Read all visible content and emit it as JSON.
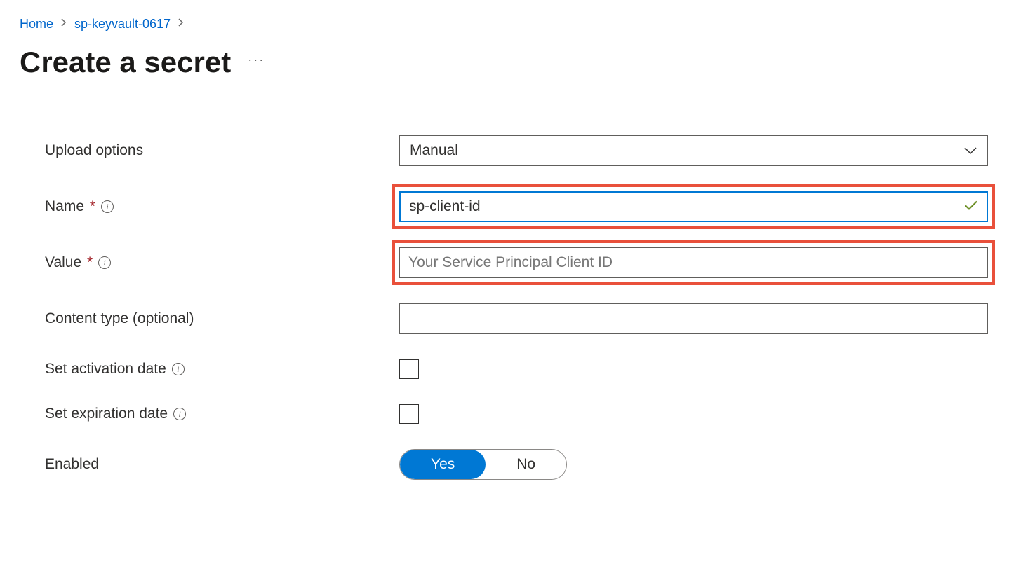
{
  "breadcrumb": {
    "home": "Home",
    "resource": "sp-keyvault-0617"
  },
  "page": {
    "title": "Create a secret"
  },
  "form": {
    "uploadOptions": {
      "label": "Upload options",
      "value": "Manual"
    },
    "name": {
      "label": "Name",
      "value": "sp-client-id"
    },
    "value": {
      "label": "Value",
      "placeholder": "Your Service Principal Client ID"
    },
    "contentType": {
      "label": "Content type (optional)",
      "value": ""
    },
    "activationDate": {
      "label": "Set activation date"
    },
    "expirationDate": {
      "label": "Set expiration date"
    },
    "enabled": {
      "label": "Enabled",
      "yes": "Yes",
      "no": "No"
    }
  }
}
